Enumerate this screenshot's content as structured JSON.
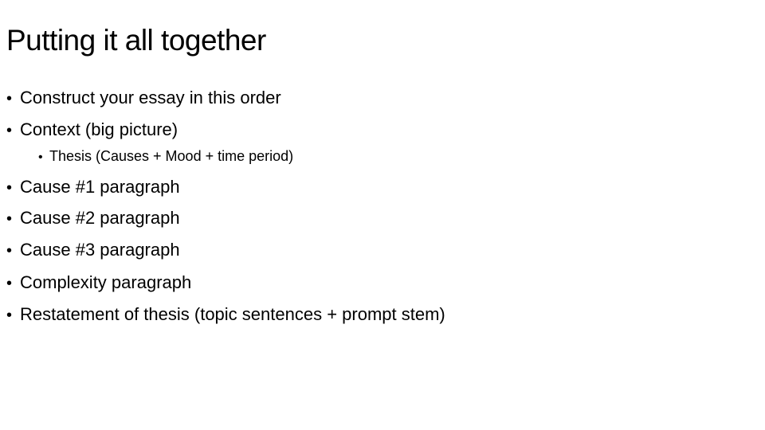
{
  "slide": {
    "title": "Putting it all together",
    "bullets": [
      {
        "level": 1,
        "marker": "•",
        "text": "Construct your essay in this order"
      },
      {
        "level": 1,
        "marker": "•",
        "text": "Context (big picture)"
      },
      {
        "level": 2,
        "marker": "•",
        "text": "Thesis (Causes + Mood + time period)"
      },
      {
        "level": 1,
        "marker": "•",
        "text": "Cause #1 paragraph"
      },
      {
        "level": 1,
        "marker": "•",
        "text": "Cause #2 paragraph"
      },
      {
        "level": 1,
        "marker": "•",
        "text": "Cause #3 paragraph"
      },
      {
        "level": 1,
        "marker": "•",
        "text": "Complexity paragraph"
      },
      {
        "level": 1,
        "marker": "•",
        "text": "Restatement of thesis (topic sentences + prompt stem)"
      }
    ]
  }
}
